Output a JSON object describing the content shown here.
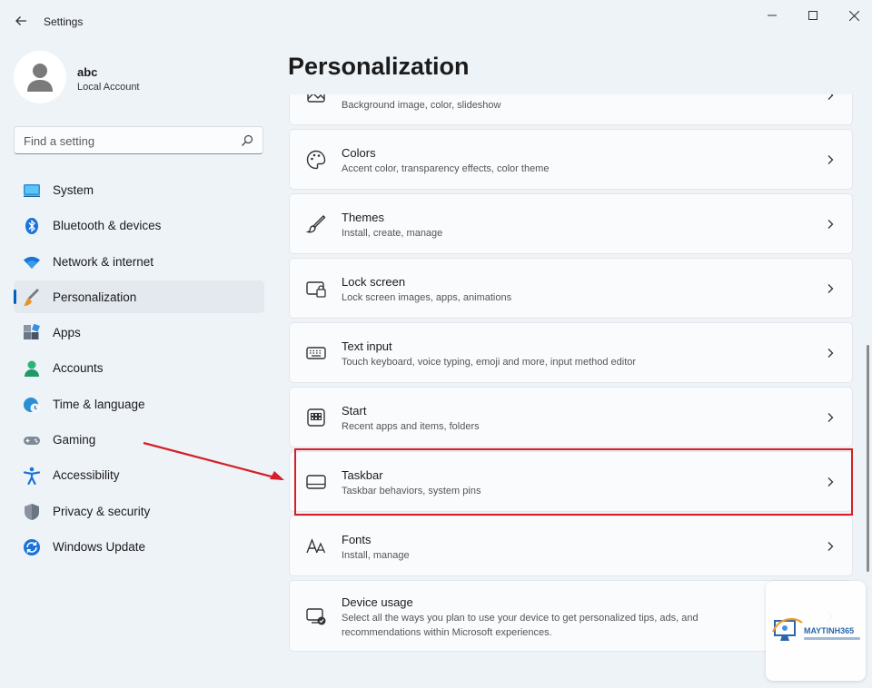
{
  "window": {
    "title": "Settings"
  },
  "profile": {
    "name": "abc",
    "account_type": "Local Account"
  },
  "search": {
    "placeholder": "Find a setting"
  },
  "nav": {
    "items": [
      {
        "label": "System",
        "icon": "system-icon"
      },
      {
        "label": "Bluetooth & devices",
        "icon": "bluetooth-icon"
      },
      {
        "label": "Network & internet",
        "icon": "wifi-icon"
      },
      {
        "label": "Personalization",
        "icon": "brush-icon",
        "active": true
      },
      {
        "label": "Apps",
        "icon": "apps-icon"
      },
      {
        "label": "Accounts",
        "icon": "person-icon"
      },
      {
        "label": "Time & language",
        "icon": "globe-clock-icon"
      },
      {
        "label": "Gaming",
        "icon": "gamepad-icon"
      },
      {
        "label": "Accessibility",
        "icon": "accessibility-icon"
      },
      {
        "label": "Privacy & security",
        "icon": "shield-icon"
      },
      {
        "label": "Windows Update",
        "icon": "update-icon"
      }
    ]
  },
  "page": {
    "title": "Personalization"
  },
  "settings": [
    {
      "title": "",
      "desc": "Background image, color, slideshow",
      "icon": "image-icon"
    },
    {
      "title": "Colors",
      "desc": "Accent color, transparency effects, color theme",
      "icon": "palette-icon"
    },
    {
      "title": "Themes",
      "desc": "Install, create, manage",
      "icon": "brush-icon"
    },
    {
      "title": "Lock screen",
      "desc": "Lock screen images, apps, animations",
      "icon": "lock-screen-icon"
    },
    {
      "title": "Text input",
      "desc": "Touch keyboard, voice typing, emoji and more, input method editor",
      "icon": "keyboard-icon"
    },
    {
      "title": "Start",
      "desc": "Recent apps and items, folders",
      "icon": "start-icon"
    },
    {
      "title": "Taskbar",
      "desc": "Taskbar behaviors, system pins",
      "icon": "taskbar-icon",
      "highlighted": true
    },
    {
      "title": "Fonts",
      "desc": "Install, manage",
      "icon": "font-icon"
    },
    {
      "title": "Device usage",
      "desc": "Select all the ways you plan to use your device to get personalized tips, ads, and recommendations within Microsoft experiences.",
      "icon": "device-usage-icon"
    }
  ],
  "watermark": {
    "brand": "MAYTINH365"
  },
  "colors": {
    "accent": "#005fb8",
    "highlight": "#d41f26",
    "background": "#eef3f8",
    "card": "#f9fbfd"
  }
}
